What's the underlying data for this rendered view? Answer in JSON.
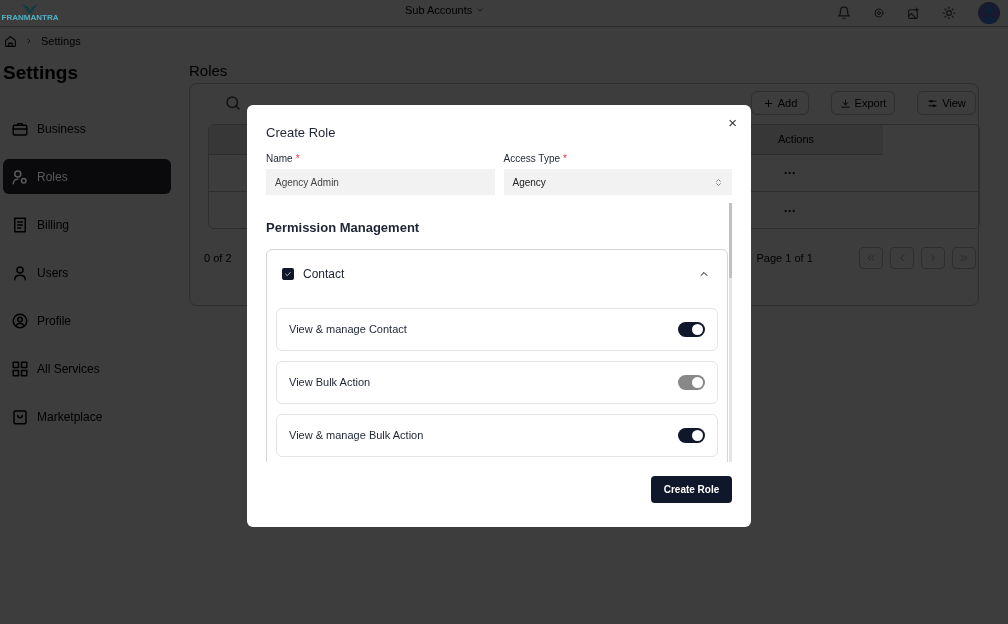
{
  "header": {
    "logo_text": "FRANMANTRA",
    "menu": "Sub Accounts"
  },
  "breadcrumb": {
    "current": "Settings"
  },
  "sidebar": {
    "title": "Settings",
    "items": [
      {
        "label": "Business",
        "selected": false
      },
      {
        "label": "Roles",
        "selected": true
      },
      {
        "label": "Billing",
        "selected": false
      },
      {
        "label": "Users",
        "selected": false
      },
      {
        "label": "Profile",
        "selected": false
      },
      {
        "label": "All Services",
        "selected": false
      },
      {
        "label": "Marketplace",
        "selected": false
      }
    ]
  },
  "main": {
    "title": "Roles",
    "toolbar": [
      "Add",
      "Export",
      "View"
    ],
    "table": {
      "columns": [
        "Actions"
      ],
      "rows": [
        {
          "actions": "···"
        },
        {
          "actions": "···"
        }
      ]
    },
    "footer": {
      "count": "0 of 2",
      "page": "Page 1 of 1"
    }
  },
  "dialog": {
    "title": "Create Role",
    "close": "×",
    "fields": [
      {
        "label": "Name",
        "required": true,
        "value": "Agency Admin",
        "kind": "text"
      },
      {
        "label": "Access Type",
        "required": true,
        "value": "Agency",
        "kind": "select"
      }
    ],
    "section_title": "Permission Management",
    "groups": [
      {
        "label": "Contact",
        "checked": true,
        "expanded": true,
        "permissions": [
          {
            "label": "View & manage Contact",
            "on": true,
            "disabled": false
          },
          {
            "label": "View Bulk Action",
            "on": true,
            "disabled": true
          },
          {
            "label": "View & manage Bulk Action",
            "on": true,
            "disabled": false
          }
        ]
      }
    ],
    "required_mark": "*",
    "submit": "Create Role"
  }
}
